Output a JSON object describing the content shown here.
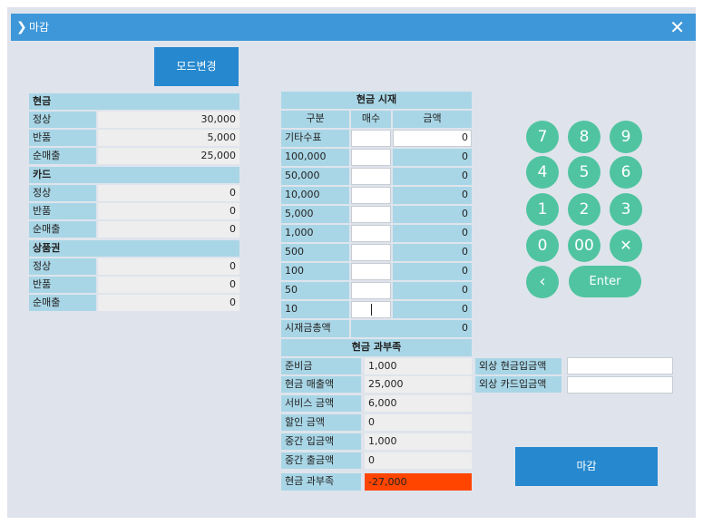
{
  "window": {
    "title": "마감",
    "chevron_icon": "chevron-right-icon",
    "close_icon": "close-icon"
  },
  "mode_button": "모드변경",
  "left": {
    "sections": [
      {
        "title": "현금",
        "rows": [
          {
            "label": "정상",
            "value": "30,000"
          },
          {
            "label": "반품",
            "value": "5,000"
          },
          {
            "label": "순매출",
            "value": "25,000"
          }
        ]
      },
      {
        "title": "카드",
        "rows": [
          {
            "label": "정상",
            "value": "0"
          },
          {
            "label": "반품",
            "value": "0"
          },
          {
            "label": "순매출",
            "value": "0"
          }
        ]
      },
      {
        "title": "상품권",
        "rows": [
          {
            "label": "정상",
            "value": "0"
          },
          {
            "label": "반품",
            "value": "0"
          },
          {
            "label": "순매출",
            "value": "0"
          }
        ]
      }
    ]
  },
  "cash_count": {
    "title": "현금 시재",
    "columns": [
      "구분",
      "매수",
      "금액"
    ],
    "rows": [
      {
        "label": "기타수표",
        "count": "",
        "amount": "0"
      },
      {
        "label": "100,000",
        "count": "",
        "amount": "0"
      },
      {
        "label": "50,000",
        "count": "",
        "amount": "0"
      },
      {
        "label": "10,000",
        "count": "",
        "amount": "0"
      },
      {
        "label": "5,000",
        "count": "",
        "amount": "0"
      },
      {
        "label": "1,000",
        "count": "",
        "amount": "0"
      },
      {
        "label": "500",
        "count": "",
        "amount": "0"
      },
      {
        "label": "100",
        "count": "",
        "amount": "0"
      },
      {
        "label": "50",
        "count": "",
        "amount": "0"
      },
      {
        "label": "10",
        "count": "",
        "amount": "0"
      }
    ],
    "total_label": "시재금총액",
    "total_value": "0"
  },
  "cash_diff": {
    "title": "현금 과부족",
    "rows": [
      {
        "label": "준비금",
        "value": "1,000"
      },
      {
        "label": "현금 매출액",
        "value": "25,000"
      },
      {
        "label": "서비스 금액",
        "value": "6,000"
      },
      {
        "label": "할인 금액",
        "value": "0"
      },
      {
        "label": "중간 입금액",
        "value": "1,000"
      },
      {
        "label": "중간 출금액",
        "value": "0"
      }
    ],
    "result_label": "현금 과부족",
    "result_value": "-27,000",
    "result_color": "#ff4500"
  },
  "credit": {
    "rows": [
      {
        "label": "외상 현금입금액",
        "value": ""
      },
      {
        "label": "외상 카드입금액",
        "value": ""
      }
    ]
  },
  "keypad": {
    "keys": [
      "7",
      "8",
      "9",
      "4",
      "5",
      "6",
      "1",
      "2",
      "3",
      "0",
      "00"
    ],
    "clear_icon": "clear-icon",
    "back_icon": "backspace-icon",
    "enter_label": "Enter",
    "color": "#50c4a0"
  },
  "close_button": "마감",
  "accent_color": "#2688cf",
  "label_bg": "#a9d6e6"
}
